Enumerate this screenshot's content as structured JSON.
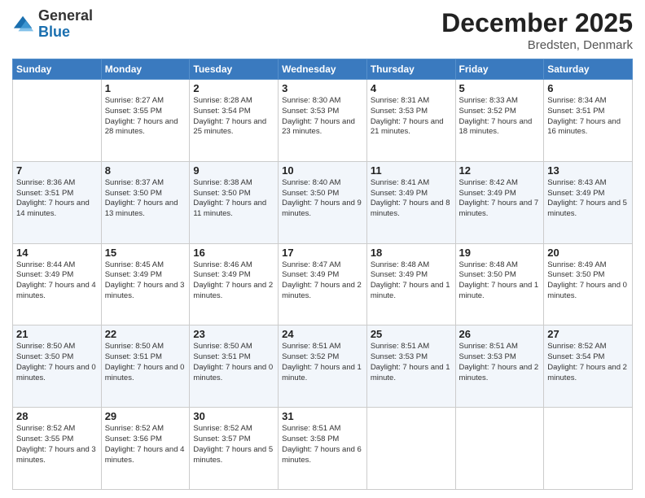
{
  "header": {
    "logo_general": "General",
    "logo_blue": "Blue",
    "main_title": "December 2025",
    "subtitle": "Bredsten, Denmark"
  },
  "days_of_week": [
    "Sunday",
    "Monday",
    "Tuesday",
    "Wednesday",
    "Thursday",
    "Friday",
    "Saturday"
  ],
  "weeks": [
    [
      {
        "day": "",
        "sunrise": "",
        "sunset": "",
        "daylight": ""
      },
      {
        "day": "1",
        "sunrise": "Sunrise: 8:27 AM",
        "sunset": "Sunset: 3:55 PM",
        "daylight": "Daylight: 7 hours and 28 minutes."
      },
      {
        "day": "2",
        "sunrise": "Sunrise: 8:28 AM",
        "sunset": "Sunset: 3:54 PM",
        "daylight": "Daylight: 7 hours and 25 minutes."
      },
      {
        "day": "3",
        "sunrise": "Sunrise: 8:30 AM",
        "sunset": "Sunset: 3:53 PM",
        "daylight": "Daylight: 7 hours and 23 minutes."
      },
      {
        "day": "4",
        "sunrise": "Sunrise: 8:31 AM",
        "sunset": "Sunset: 3:53 PM",
        "daylight": "Daylight: 7 hours and 21 minutes."
      },
      {
        "day": "5",
        "sunrise": "Sunrise: 8:33 AM",
        "sunset": "Sunset: 3:52 PM",
        "daylight": "Daylight: 7 hours and 18 minutes."
      },
      {
        "day": "6",
        "sunrise": "Sunrise: 8:34 AM",
        "sunset": "Sunset: 3:51 PM",
        "daylight": "Daylight: 7 hours and 16 minutes."
      }
    ],
    [
      {
        "day": "7",
        "sunrise": "Sunrise: 8:36 AM",
        "sunset": "Sunset: 3:51 PM",
        "daylight": "Daylight: 7 hours and 14 minutes."
      },
      {
        "day": "8",
        "sunrise": "Sunrise: 8:37 AM",
        "sunset": "Sunset: 3:50 PM",
        "daylight": "Daylight: 7 hours and 13 minutes."
      },
      {
        "day": "9",
        "sunrise": "Sunrise: 8:38 AM",
        "sunset": "Sunset: 3:50 PM",
        "daylight": "Daylight: 7 hours and 11 minutes."
      },
      {
        "day": "10",
        "sunrise": "Sunrise: 8:40 AM",
        "sunset": "Sunset: 3:50 PM",
        "daylight": "Daylight: 7 hours and 9 minutes."
      },
      {
        "day": "11",
        "sunrise": "Sunrise: 8:41 AM",
        "sunset": "Sunset: 3:49 PM",
        "daylight": "Daylight: 7 hours and 8 minutes."
      },
      {
        "day": "12",
        "sunrise": "Sunrise: 8:42 AM",
        "sunset": "Sunset: 3:49 PM",
        "daylight": "Daylight: 7 hours and 7 minutes."
      },
      {
        "day": "13",
        "sunrise": "Sunrise: 8:43 AM",
        "sunset": "Sunset: 3:49 PM",
        "daylight": "Daylight: 7 hours and 5 minutes."
      }
    ],
    [
      {
        "day": "14",
        "sunrise": "Sunrise: 8:44 AM",
        "sunset": "Sunset: 3:49 PM",
        "daylight": "Daylight: 7 hours and 4 minutes."
      },
      {
        "day": "15",
        "sunrise": "Sunrise: 8:45 AM",
        "sunset": "Sunset: 3:49 PM",
        "daylight": "Daylight: 7 hours and 3 minutes."
      },
      {
        "day": "16",
        "sunrise": "Sunrise: 8:46 AM",
        "sunset": "Sunset: 3:49 PM",
        "daylight": "Daylight: 7 hours and 2 minutes."
      },
      {
        "day": "17",
        "sunrise": "Sunrise: 8:47 AM",
        "sunset": "Sunset: 3:49 PM",
        "daylight": "Daylight: 7 hours and 2 minutes."
      },
      {
        "day": "18",
        "sunrise": "Sunrise: 8:48 AM",
        "sunset": "Sunset: 3:49 PM",
        "daylight": "Daylight: 7 hours and 1 minute."
      },
      {
        "day": "19",
        "sunrise": "Sunrise: 8:48 AM",
        "sunset": "Sunset: 3:50 PM",
        "daylight": "Daylight: 7 hours and 1 minute."
      },
      {
        "day": "20",
        "sunrise": "Sunrise: 8:49 AM",
        "sunset": "Sunset: 3:50 PM",
        "daylight": "Daylight: 7 hours and 0 minutes."
      }
    ],
    [
      {
        "day": "21",
        "sunrise": "Sunrise: 8:50 AM",
        "sunset": "Sunset: 3:50 PM",
        "daylight": "Daylight: 7 hours and 0 minutes."
      },
      {
        "day": "22",
        "sunrise": "Sunrise: 8:50 AM",
        "sunset": "Sunset: 3:51 PM",
        "daylight": "Daylight: 7 hours and 0 minutes."
      },
      {
        "day": "23",
        "sunrise": "Sunrise: 8:50 AM",
        "sunset": "Sunset: 3:51 PM",
        "daylight": "Daylight: 7 hours and 0 minutes."
      },
      {
        "day": "24",
        "sunrise": "Sunrise: 8:51 AM",
        "sunset": "Sunset: 3:52 PM",
        "daylight": "Daylight: 7 hours and 1 minute."
      },
      {
        "day": "25",
        "sunrise": "Sunrise: 8:51 AM",
        "sunset": "Sunset: 3:53 PM",
        "daylight": "Daylight: 7 hours and 1 minute."
      },
      {
        "day": "26",
        "sunrise": "Sunrise: 8:51 AM",
        "sunset": "Sunset: 3:53 PM",
        "daylight": "Daylight: 7 hours and 2 minutes."
      },
      {
        "day": "27",
        "sunrise": "Sunrise: 8:52 AM",
        "sunset": "Sunset: 3:54 PM",
        "daylight": "Daylight: 7 hours and 2 minutes."
      }
    ],
    [
      {
        "day": "28",
        "sunrise": "Sunrise: 8:52 AM",
        "sunset": "Sunset: 3:55 PM",
        "daylight": "Daylight: 7 hours and 3 minutes."
      },
      {
        "day": "29",
        "sunrise": "Sunrise: 8:52 AM",
        "sunset": "Sunset: 3:56 PM",
        "daylight": "Daylight: 7 hours and 4 minutes."
      },
      {
        "day": "30",
        "sunrise": "Sunrise: 8:52 AM",
        "sunset": "Sunset: 3:57 PM",
        "daylight": "Daylight: 7 hours and 5 minutes."
      },
      {
        "day": "31",
        "sunrise": "Sunrise: 8:51 AM",
        "sunset": "Sunset: 3:58 PM",
        "daylight": "Daylight: 7 hours and 6 minutes."
      },
      {
        "day": "",
        "sunrise": "",
        "sunset": "",
        "daylight": ""
      },
      {
        "day": "",
        "sunrise": "",
        "sunset": "",
        "daylight": ""
      },
      {
        "day": "",
        "sunrise": "",
        "sunset": "",
        "daylight": ""
      }
    ]
  ]
}
